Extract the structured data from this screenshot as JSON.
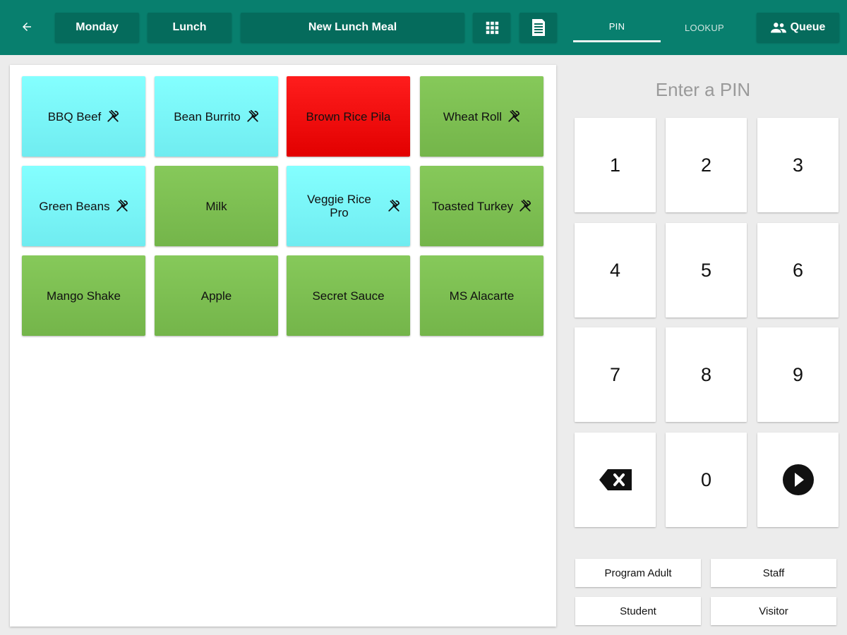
{
  "header": {
    "day": "Monday",
    "meal_period": "Lunch",
    "meal_name": "New Lunch Meal",
    "tabs": [
      {
        "label": "PIN",
        "active": true
      },
      {
        "label": "LOOKUP",
        "active": false
      }
    ],
    "queue_label": "Queue",
    "icons": [
      "arrow-back-icon",
      "grid-icon",
      "receipt-icon",
      "people-icon"
    ],
    "colors": {
      "bar": "#087f6e",
      "button": "#056b5c"
    }
  },
  "menu_items": [
    {
      "label": "BBQ Beef",
      "color": "cyan",
      "entree": true
    },
    {
      "label": "Bean Burrito",
      "color": "cyan",
      "entree": true
    },
    {
      "label": "Brown Rice Pila",
      "color": "red",
      "entree": false
    },
    {
      "label": "Wheat Roll",
      "color": "green",
      "entree": true
    },
    {
      "label": "Green Beans",
      "color": "cyan",
      "entree": true
    },
    {
      "label": "Milk",
      "color": "green",
      "entree": false
    },
    {
      "label": "Veggie Rice Pro",
      "color": "cyan",
      "entree": true
    },
    {
      "label": "Toasted Turkey",
      "color": "green",
      "entree": true
    },
    {
      "label": "Mango Shake",
      "color": "green",
      "entree": false
    },
    {
      "label": "Apple",
      "color": "green",
      "entree": false
    },
    {
      "label": "Secret Sauce",
      "color": "green",
      "entree": false
    },
    {
      "label": "MS Alacarte",
      "color": "green",
      "entree": false
    }
  ],
  "pin": {
    "title": "Enter a PIN",
    "keys": [
      "1",
      "2",
      "3",
      "4",
      "5",
      "6",
      "7",
      "8",
      "9",
      "backspace",
      "0",
      "submit"
    ]
  },
  "roles": [
    "Program Adult",
    "Staff",
    "Student",
    "Visitor"
  ]
}
